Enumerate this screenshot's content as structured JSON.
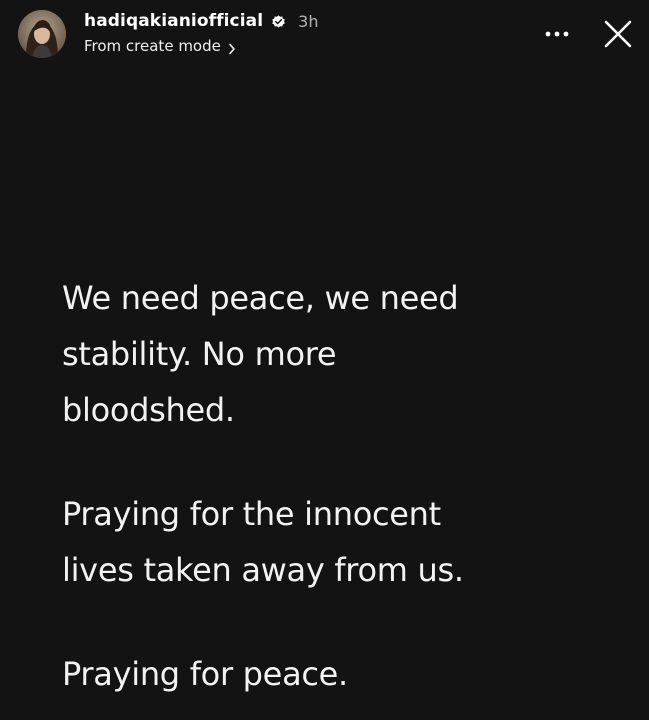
{
  "story": {
    "username": "hadiqakianiofficial",
    "verified": true,
    "time_ago": "3h",
    "subtitle": "From create mode",
    "more_icon": "more-horizontal-icon",
    "close_icon": "close-icon",
    "background_color": "#131313",
    "text_color": "#f2f2f2",
    "paragraphs": [
      "We need peace, we need\nstability. No more\nbloodshed.",
      "Praying for the innocent\nlives taken away from us.",
      "Praying for peace."
    ]
  }
}
